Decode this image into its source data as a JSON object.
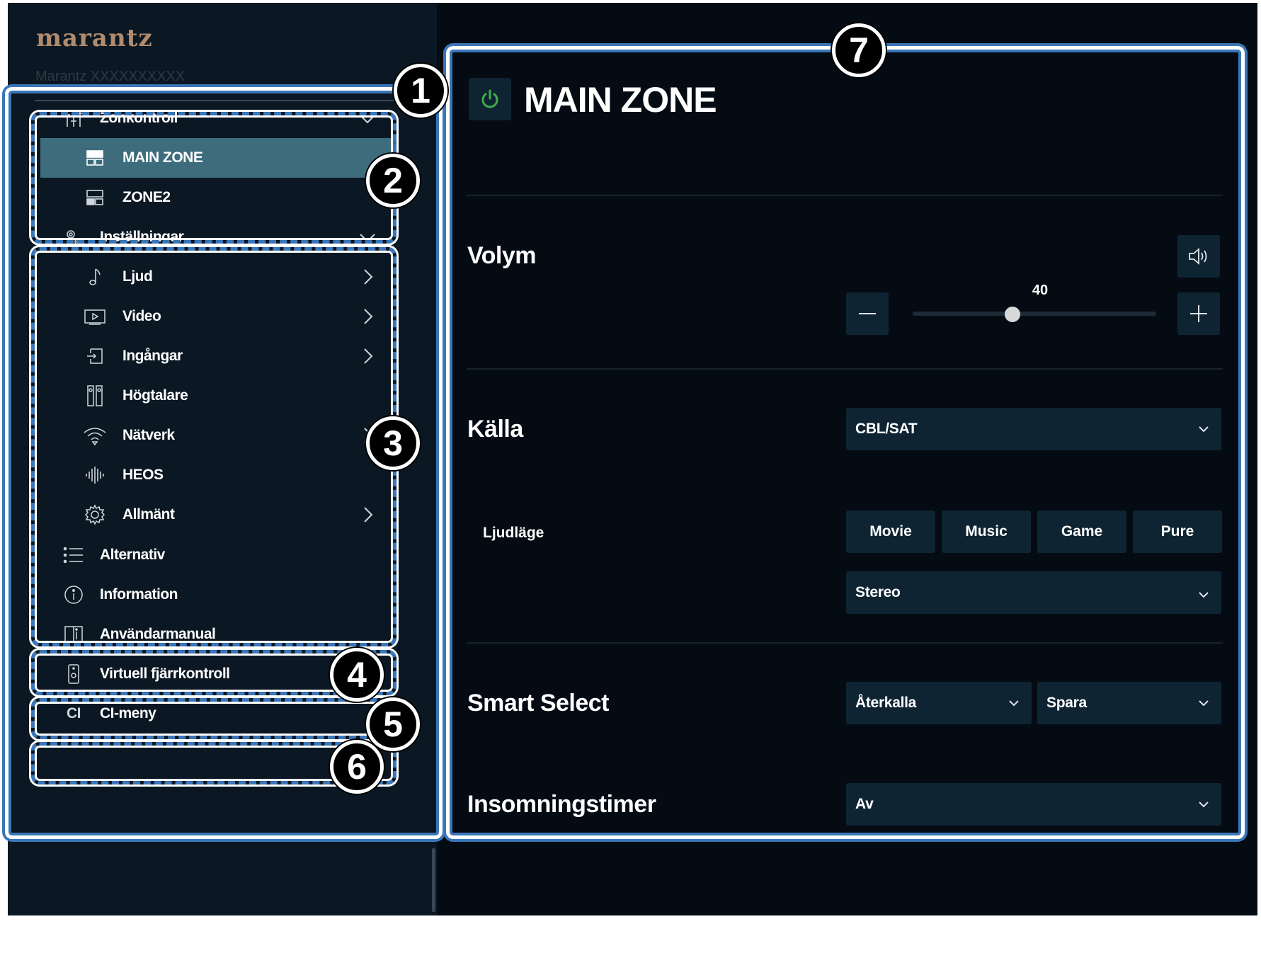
{
  "brand": {
    "logo_text": "marantz",
    "device_name": "Marantz XXXXXXXXXX"
  },
  "sidebar": {
    "zone_control": {
      "label": "Zonkontroll",
      "icon": "sliders-icon",
      "items": [
        {
          "label": "MAIN ZONE",
          "icon": "zone-icon",
          "active": true
        },
        {
          "label": "ZONE2",
          "icon": "zone-icon",
          "active": false
        }
      ]
    },
    "settings": {
      "label": "Inställningar",
      "icon": "gears-icon",
      "items": [
        {
          "label": "Ljud",
          "icon": "music-note-icon",
          "has_arrow": true
        },
        {
          "label": "Video",
          "icon": "video-icon",
          "has_arrow": true
        },
        {
          "label": "Ingångar",
          "icon": "input-icon",
          "has_arrow": true
        },
        {
          "label": "Högtalare",
          "icon": "speakers-icon",
          "has_arrow": false
        },
        {
          "label": "Nätverk",
          "icon": "wifi-icon",
          "has_arrow": true
        },
        {
          "label": "HEOS",
          "icon": "heos-icon",
          "has_arrow": false
        },
        {
          "label": "Allmänt",
          "icon": "gear-icon",
          "has_arrow": true
        }
      ]
    },
    "alternativ": {
      "label": "Alternativ",
      "icon": "list-icon"
    },
    "information": {
      "label": "Information",
      "icon": "info-icon"
    },
    "manual": {
      "label": "Användarmanual",
      "icon": "book-icon"
    },
    "remote": {
      "label": "Virtuell fjärrkontroll",
      "icon": "remote-icon"
    },
    "ci": {
      "icon_text": "CI",
      "label": "CI-meny"
    }
  },
  "main": {
    "title": "MAIN ZONE",
    "power_on": true,
    "volume": {
      "label": "Volym",
      "value": "40",
      "level": 0.41
    },
    "source": {
      "label": "Källa",
      "value": "CBL/SAT"
    },
    "sound_mode": {
      "label": "Ljudläge",
      "buttons": [
        "Movie",
        "Music",
        "Game",
        "Pure"
      ],
      "value": "Stereo"
    },
    "smart_select": {
      "label": "Smart Select",
      "recall": "Återkalla",
      "save": "Spara"
    },
    "sleep_timer": {
      "label": "Insomningstimer",
      "value": "Av"
    }
  },
  "callouts": [
    "1",
    "2",
    "3",
    "4",
    "5",
    "6",
    "7"
  ],
  "colors": {
    "accent": "#3d6d7c",
    "annotation": "#3a76b9",
    "power": "#3fae49",
    "brand": "#b08b6e"
  }
}
